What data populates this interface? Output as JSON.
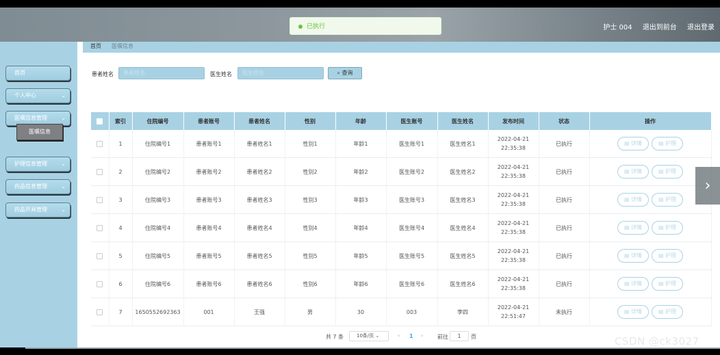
{
  "toast": {
    "text": "已执行"
  },
  "header": {
    "user": "护士 004",
    "back_to_front": "退出到前台",
    "logout": "退出登录"
  },
  "sidebar": {
    "items": [
      {
        "label": "首页",
        "has_chevron": false
      },
      {
        "label": "个人中心",
        "has_chevron": true
      },
      {
        "label": "医嘱信息管理",
        "has_chevron": true
      },
      {
        "label": "护理信息管理",
        "has_chevron": true
      },
      {
        "label": "药品信息管理",
        "has_chevron": true
      },
      {
        "label": "药品开具管理",
        "has_chevron": true
      }
    ],
    "submenu_active": "医嘱信息"
  },
  "breadcrumb": {
    "home": "首页",
    "current": "医嘱信息"
  },
  "search": {
    "patient_label": "患者姓名",
    "patient_placeholder": "患者姓名",
    "doctor_label": "医生姓名",
    "doctor_placeholder": "医生姓名",
    "button_label": "查询"
  },
  "table": {
    "columns": [
      "索引",
      "住院编号",
      "患者账号",
      "患者姓名",
      "性别",
      "年龄",
      "医生账号",
      "医生姓名",
      "发布时间",
      "状态",
      "操作"
    ],
    "rows": [
      {
        "index": "1",
        "admission": "住院编号1",
        "patient_acct": "患者账号1",
        "patient_name": "患者姓名1",
        "gender": "性别1",
        "age": "年龄1",
        "doctor_acct": "医生账号1",
        "doctor_name": "医生姓名1",
        "time": "2022-04-21 22:35:38",
        "status": "已执行"
      },
      {
        "index": "2",
        "admission": "住院编号2",
        "patient_acct": "患者账号2",
        "patient_name": "患者姓名2",
        "gender": "性别2",
        "age": "年龄2",
        "doctor_acct": "医生账号2",
        "doctor_name": "医生姓名2",
        "time": "2022-04-21 22:35:38",
        "status": "已执行"
      },
      {
        "index": "3",
        "admission": "住院编号3",
        "patient_acct": "患者账号3",
        "patient_name": "患者姓名3",
        "gender": "性别3",
        "age": "年龄3",
        "doctor_acct": "医生账号3",
        "doctor_name": "医生姓名3",
        "time": "2022-04-21 22:35:38",
        "status": "已执行"
      },
      {
        "index": "4",
        "admission": "住院编号4",
        "patient_acct": "患者账号4",
        "patient_name": "患者姓名4",
        "gender": "性别4",
        "age": "年龄4",
        "doctor_acct": "医生账号4",
        "doctor_name": "医生姓名4",
        "time": "2022-04-21 22:35:38",
        "status": "已执行"
      },
      {
        "index": "5",
        "admission": "住院编号5",
        "patient_acct": "患者账号5",
        "patient_name": "患者姓名5",
        "gender": "性别5",
        "age": "年龄5",
        "doctor_acct": "医生账号5",
        "doctor_name": "医生姓名5",
        "time": "2022-04-21 22:35:38",
        "status": "已执行"
      },
      {
        "index": "6",
        "admission": "住院编号6",
        "patient_acct": "患者账号6",
        "patient_name": "患者姓名6",
        "gender": "性别6",
        "age": "年龄6",
        "doctor_acct": "医生账号6",
        "doctor_name": "医生姓名6",
        "time": "2022-04-21 22:35:38",
        "status": "已执行"
      },
      {
        "index": "7",
        "admission": "1650552692363",
        "patient_acct": "001",
        "patient_name": "王强",
        "gender": "男",
        "age": "30",
        "doctor_acct": "003",
        "doctor_name": "李四",
        "time": "2022-04-21 22:51:47",
        "status": "未执行"
      }
    ],
    "action_detail": "详情",
    "action_nurse": "护理"
  },
  "pagination": {
    "total_text": "共 7 条",
    "page_size": "10条/页",
    "current_page": "1",
    "goto_label": "前往",
    "goto_value": "1",
    "page_suffix": "页"
  },
  "watermark": "CSDN @ck3027",
  "colors": {
    "accent": "#a8d2e4",
    "success": "#67c23a",
    "link": "#409eff"
  },
  "icons": {
    "search": "search-icon",
    "detail": "detail-icon",
    "nurse": "nurse-icon",
    "chevron": "chevron-down-icon",
    "next": "chevron-right-icon"
  }
}
